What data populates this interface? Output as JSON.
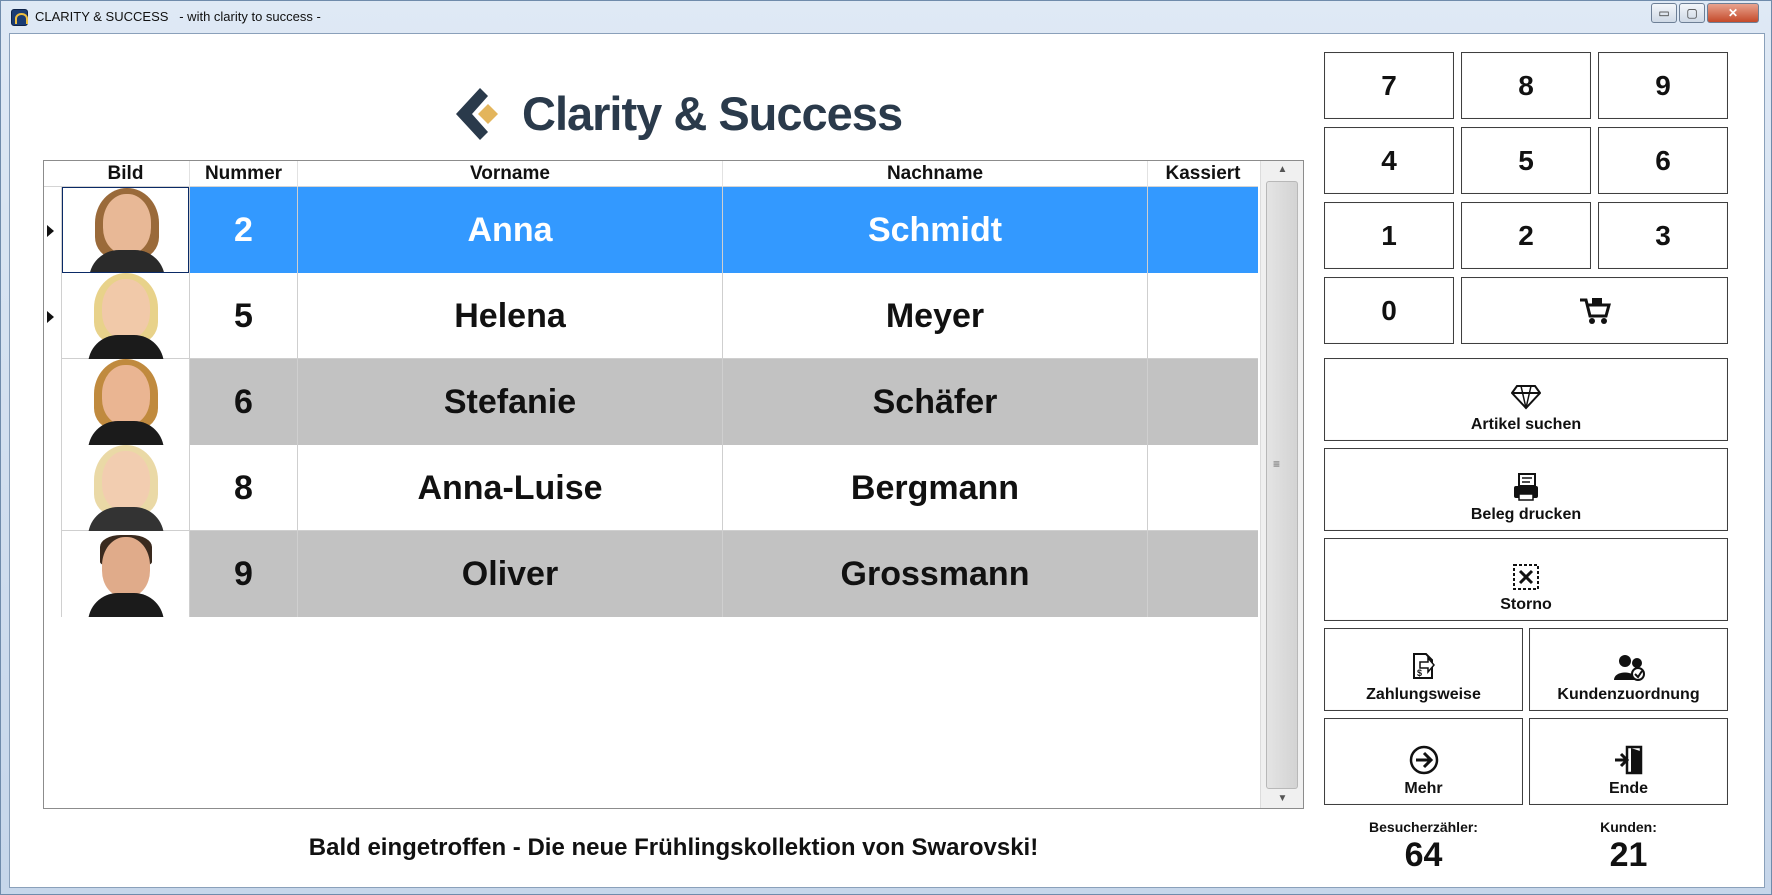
{
  "window": {
    "title": "CLARITY & SUCCESS   - with clarity to success -",
    "min_label": "▭",
    "max_label": "▢",
    "close_label": "✕"
  },
  "logo": {
    "text": "Clarity & Success"
  },
  "grid": {
    "columns": [
      "Bild",
      "Nummer",
      "Vorname",
      "Nachname",
      "Kassiert"
    ],
    "rows": [
      {
        "nummer": "2",
        "vorname": "Anna",
        "nachname": "Schmidt",
        "kassiert": "",
        "state": "selected"
      },
      {
        "nummer": "5",
        "vorname": "Helena",
        "nachname": "Meyer",
        "kassiert": "",
        "state": "plain"
      },
      {
        "nummer": "6",
        "vorname": "Stefanie",
        "nachname": "Schäfer",
        "kassiert": "",
        "state": "alt"
      },
      {
        "nummer": "8",
        "vorname": "Anna-Luise",
        "nachname": "Bergmann",
        "kassiert": "",
        "state": "plain"
      },
      {
        "nummer": "9",
        "vorname": "Oliver",
        "nachname": "Grossmann",
        "kassiert": "",
        "state": "alt"
      }
    ]
  },
  "banner": {
    "text": "Bald eingetroffen - Die neue Frühlingskollektion von Swarovski!"
  },
  "keypad": {
    "keys": [
      "7",
      "8",
      "9",
      "4",
      "5",
      "6",
      "1",
      "2",
      "3",
      "0"
    ],
    "cart_icon": "cart-icon"
  },
  "actions": {
    "artikel_suchen": "Artikel suchen",
    "beleg_drucken": "Beleg drucken",
    "storno": "Storno",
    "zahlungsweise": "Zahlungsweise",
    "kundenzuordnung": "Kundenzuordnung",
    "mehr": "Mehr",
    "ende": "Ende"
  },
  "counters": {
    "besucher_label": "Besucherzähler:",
    "besucher_value": "64",
    "kunden_label": "Kunden:",
    "kunden_value": "21"
  },
  "colors": {
    "selection": "#3399ff",
    "alt_row": "#c2c2c2",
    "logo_text": "#2a3a4b",
    "logo_accent": "#e3b55c"
  }
}
